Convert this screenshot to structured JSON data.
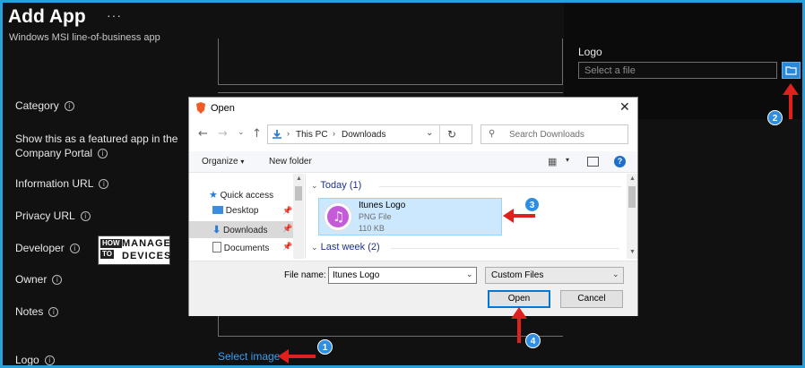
{
  "header": {
    "title": "Add App",
    "more": "···",
    "subtitle": "Windows MSI line-of-business app"
  },
  "form": {
    "labels": {
      "category": "Category",
      "featured_line1": "Show this as a featured app in the",
      "featured_line2": "Company Portal",
      "information_url": "Information URL",
      "privacy_url": "Privacy URL",
      "developer": "Developer",
      "owner": "Owner",
      "notes": "Notes",
      "logo": "Logo"
    },
    "info_glyph": "i",
    "select_image": "Select image"
  },
  "logo_panel": {
    "label": "Logo",
    "placeholder": "Select a file"
  },
  "watermark": {
    "line1_a": "HOW",
    "line1_b": "TO",
    "manage": "MANAGE",
    "devices": "DEVICES"
  },
  "dialog": {
    "title": "Open",
    "breadcrumb": [
      "This PC",
      "Downloads"
    ],
    "search_placeholder": "Search Downloads",
    "organize": "Organize",
    "new_folder": "New folder",
    "nav_items": [
      {
        "label": "Quick access",
        "icon": "star-icon"
      },
      {
        "label": "Desktop",
        "icon": "desktop-icon"
      },
      {
        "label": "Downloads",
        "icon": "download-icon"
      },
      {
        "label": "Documents",
        "icon": "documents-icon"
      }
    ],
    "groups": {
      "today": "Today (1)",
      "last_week": "Last week (2)"
    },
    "file": {
      "name": "Itunes Logo",
      "type": "PNG File",
      "size": "110 KB"
    },
    "file_name_label": "File name:",
    "file_name_value": "Itunes Logo",
    "filter_value": "Custom Files",
    "open_button": "Open",
    "cancel_button": "Cancel"
  },
  "annotations": {
    "badges": [
      "1",
      "2",
      "3",
      "4"
    ],
    "accent_color": "#2f8ee3",
    "arrow_color": "#e0201c"
  }
}
